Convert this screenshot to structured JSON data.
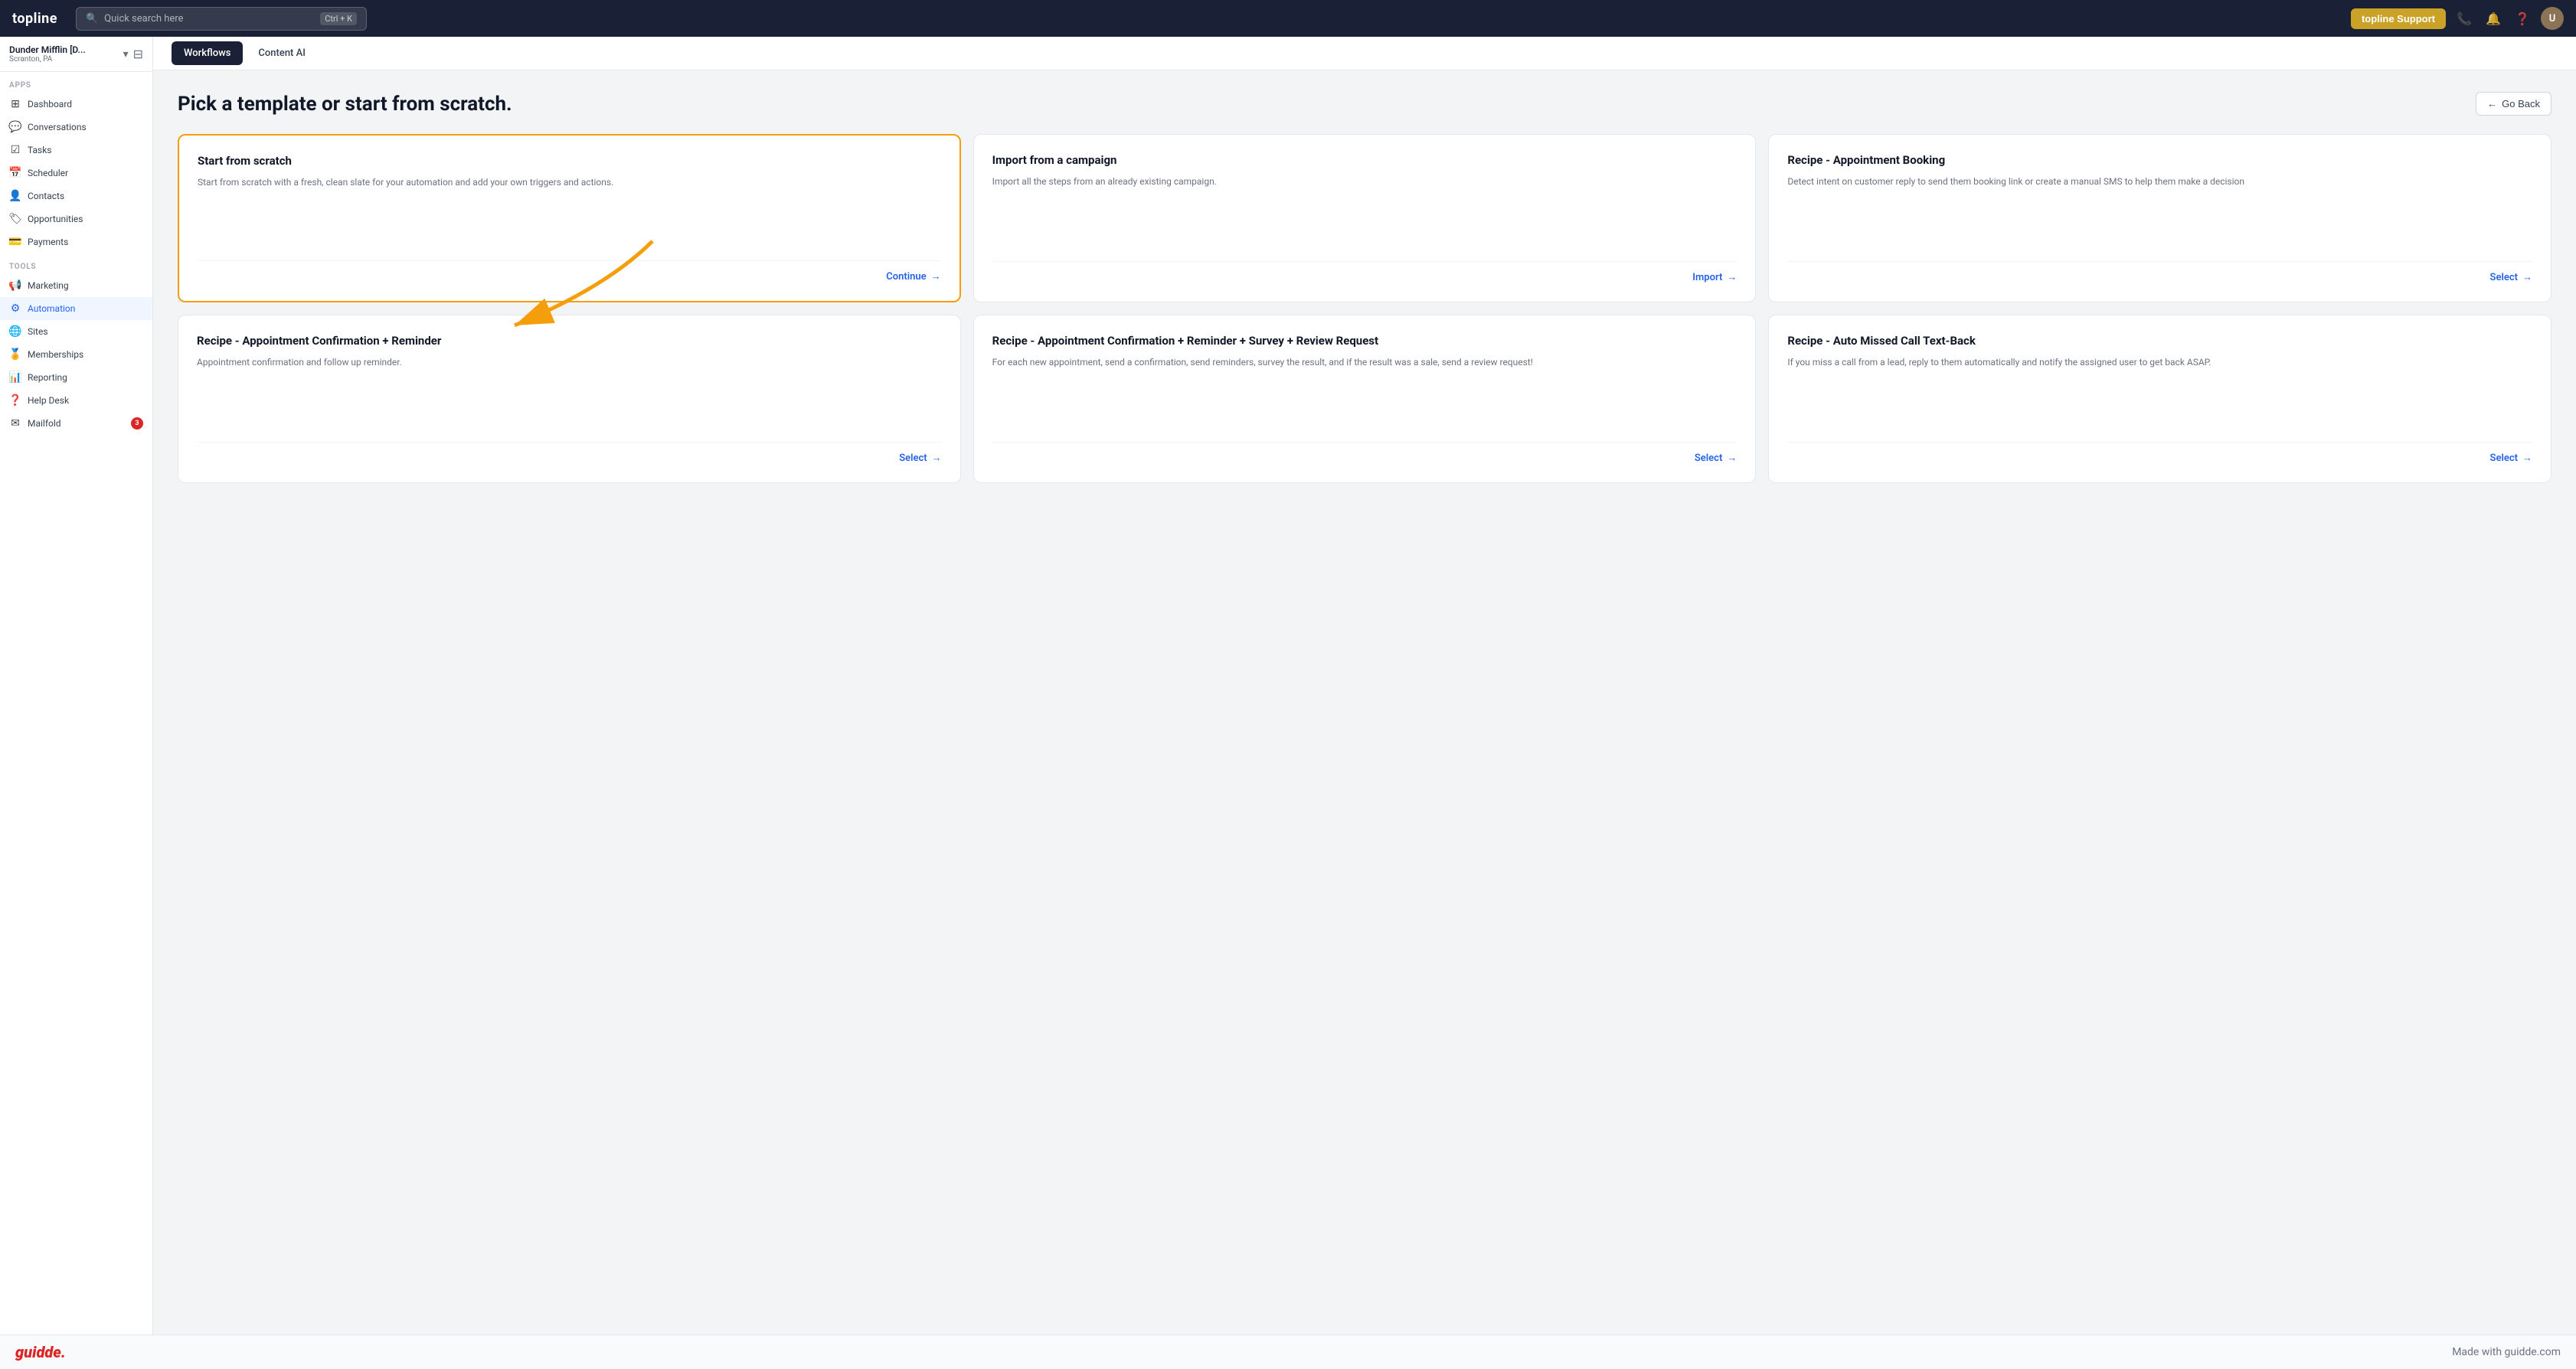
{
  "app": {
    "logo": "topline",
    "support_btn": "topline Support",
    "search_placeholder": "Quick search here",
    "search_shortcut": "Ctrl + K"
  },
  "org": {
    "name": "Dunder Mifflin [D...",
    "location": "Scranton, PA"
  },
  "sidebar": {
    "apps_label": "Apps",
    "tools_label": "Tools",
    "items": [
      {
        "label": "Dashboard",
        "icon": "⊞",
        "id": "dashboard"
      },
      {
        "label": "Conversations",
        "icon": "💬",
        "id": "conversations"
      },
      {
        "label": "Tasks",
        "icon": "☑",
        "id": "tasks"
      },
      {
        "label": "Scheduler",
        "icon": "📅",
        "id": "scheduler"
      },
      {
        "label": "Contacts",
        "icon": "👤",
        "id": "contacts"
      },
      {
        "label": "Opportunities",
        "icon": "🏷",
        "id": "opportunities"
      },
      {
        "label": "Payments",
        "icon": "💳",
        "id": "payments"
      },
      {
        "label": "Marketing",
        "icon": "📢",
        "id": "marketing"
      },
      {
        "label": "Automation",
        "icon": "⚙",
        "id": "automation",
        "active": true
      },
      {
        "label": "Sites",
        "icon": "🌐",
        "id": "sites"
      },
      {
        "label": "Memberships",
        "icon": "🏅",
        "id": "memberships"
      },
      {
        "label": "Reporting",
        "icon": "📊",
        "id": "reporting"
      },
      {
        "label": "Help Desk",
        "icon": "❓",
        "id": "helpdesk"
      },
      {
        "label": "Mailfold",
        "icon": "✉",
        "id": "mailfold",
        "badge": "3"
      }
    ]
  },
  "subnav": {
    "tabs": [
      {
        "label": "Workflows",
        "active": true
      },
      {
        "label": "Content AI",
        "active": false
      }
    ]
  },
  "page": {
    "title": "Pick a template or start from scratch.",
    "go_back": "Go Back"
  },
  "templates": [
    {
      "id": "scratch",
      "title": "Start from scratch",
      "description": "Start from scratch with a fresh, clean slate for your automation and add your own triggers and actions.",
      "action_label": "Continue",
      "selected": true
    },
    {
      "id": "campaign",
      "title": "Import from a campaign",
      "description": "Import all the steps from an already existing campaign.",
      "action_label": "Import",
      "selected": false
    },
    {
      "id": "booking",
      "title": "Recipe - Appointment Booking",
      "description": "Detect intent on customer reply to send them booking link or create a manual SMS to help them make a decision",
      "action_label": "Select",
      "selected": false
    },
    {
      "id": "confirmation",
      "title": "Recipe - Appointment Confirmation + Reminder",
      "description": "Appointment confirmation and follow up reminder.",
      "action_label": "Select",
      "selected": false
    },
    {
      "id": "confirmation-survey",
      "title": "Recipe - Appointment Confirmation + Reminder + Survey + Review Request",
      "description": "For each new appointment, send a confirmation, send reminders, survey the result, and if the result was a sale, send a review request!",
      "action_label": "Select",
      "selected": false
    },
    {
      "id": "missed-call",
      "title": "Recipe - Auto Missed Call Text-Back",
      "description": "If you miss a call from a lead, reply to them automatically and notify the assigned user to get back ASAP.",
      "action_label": "Select",
      "selected": false
    }
  ],
  "bottom_bar": {
    "logo": "guidde.",
    "text": "Made with guidde.com"
  }
}
